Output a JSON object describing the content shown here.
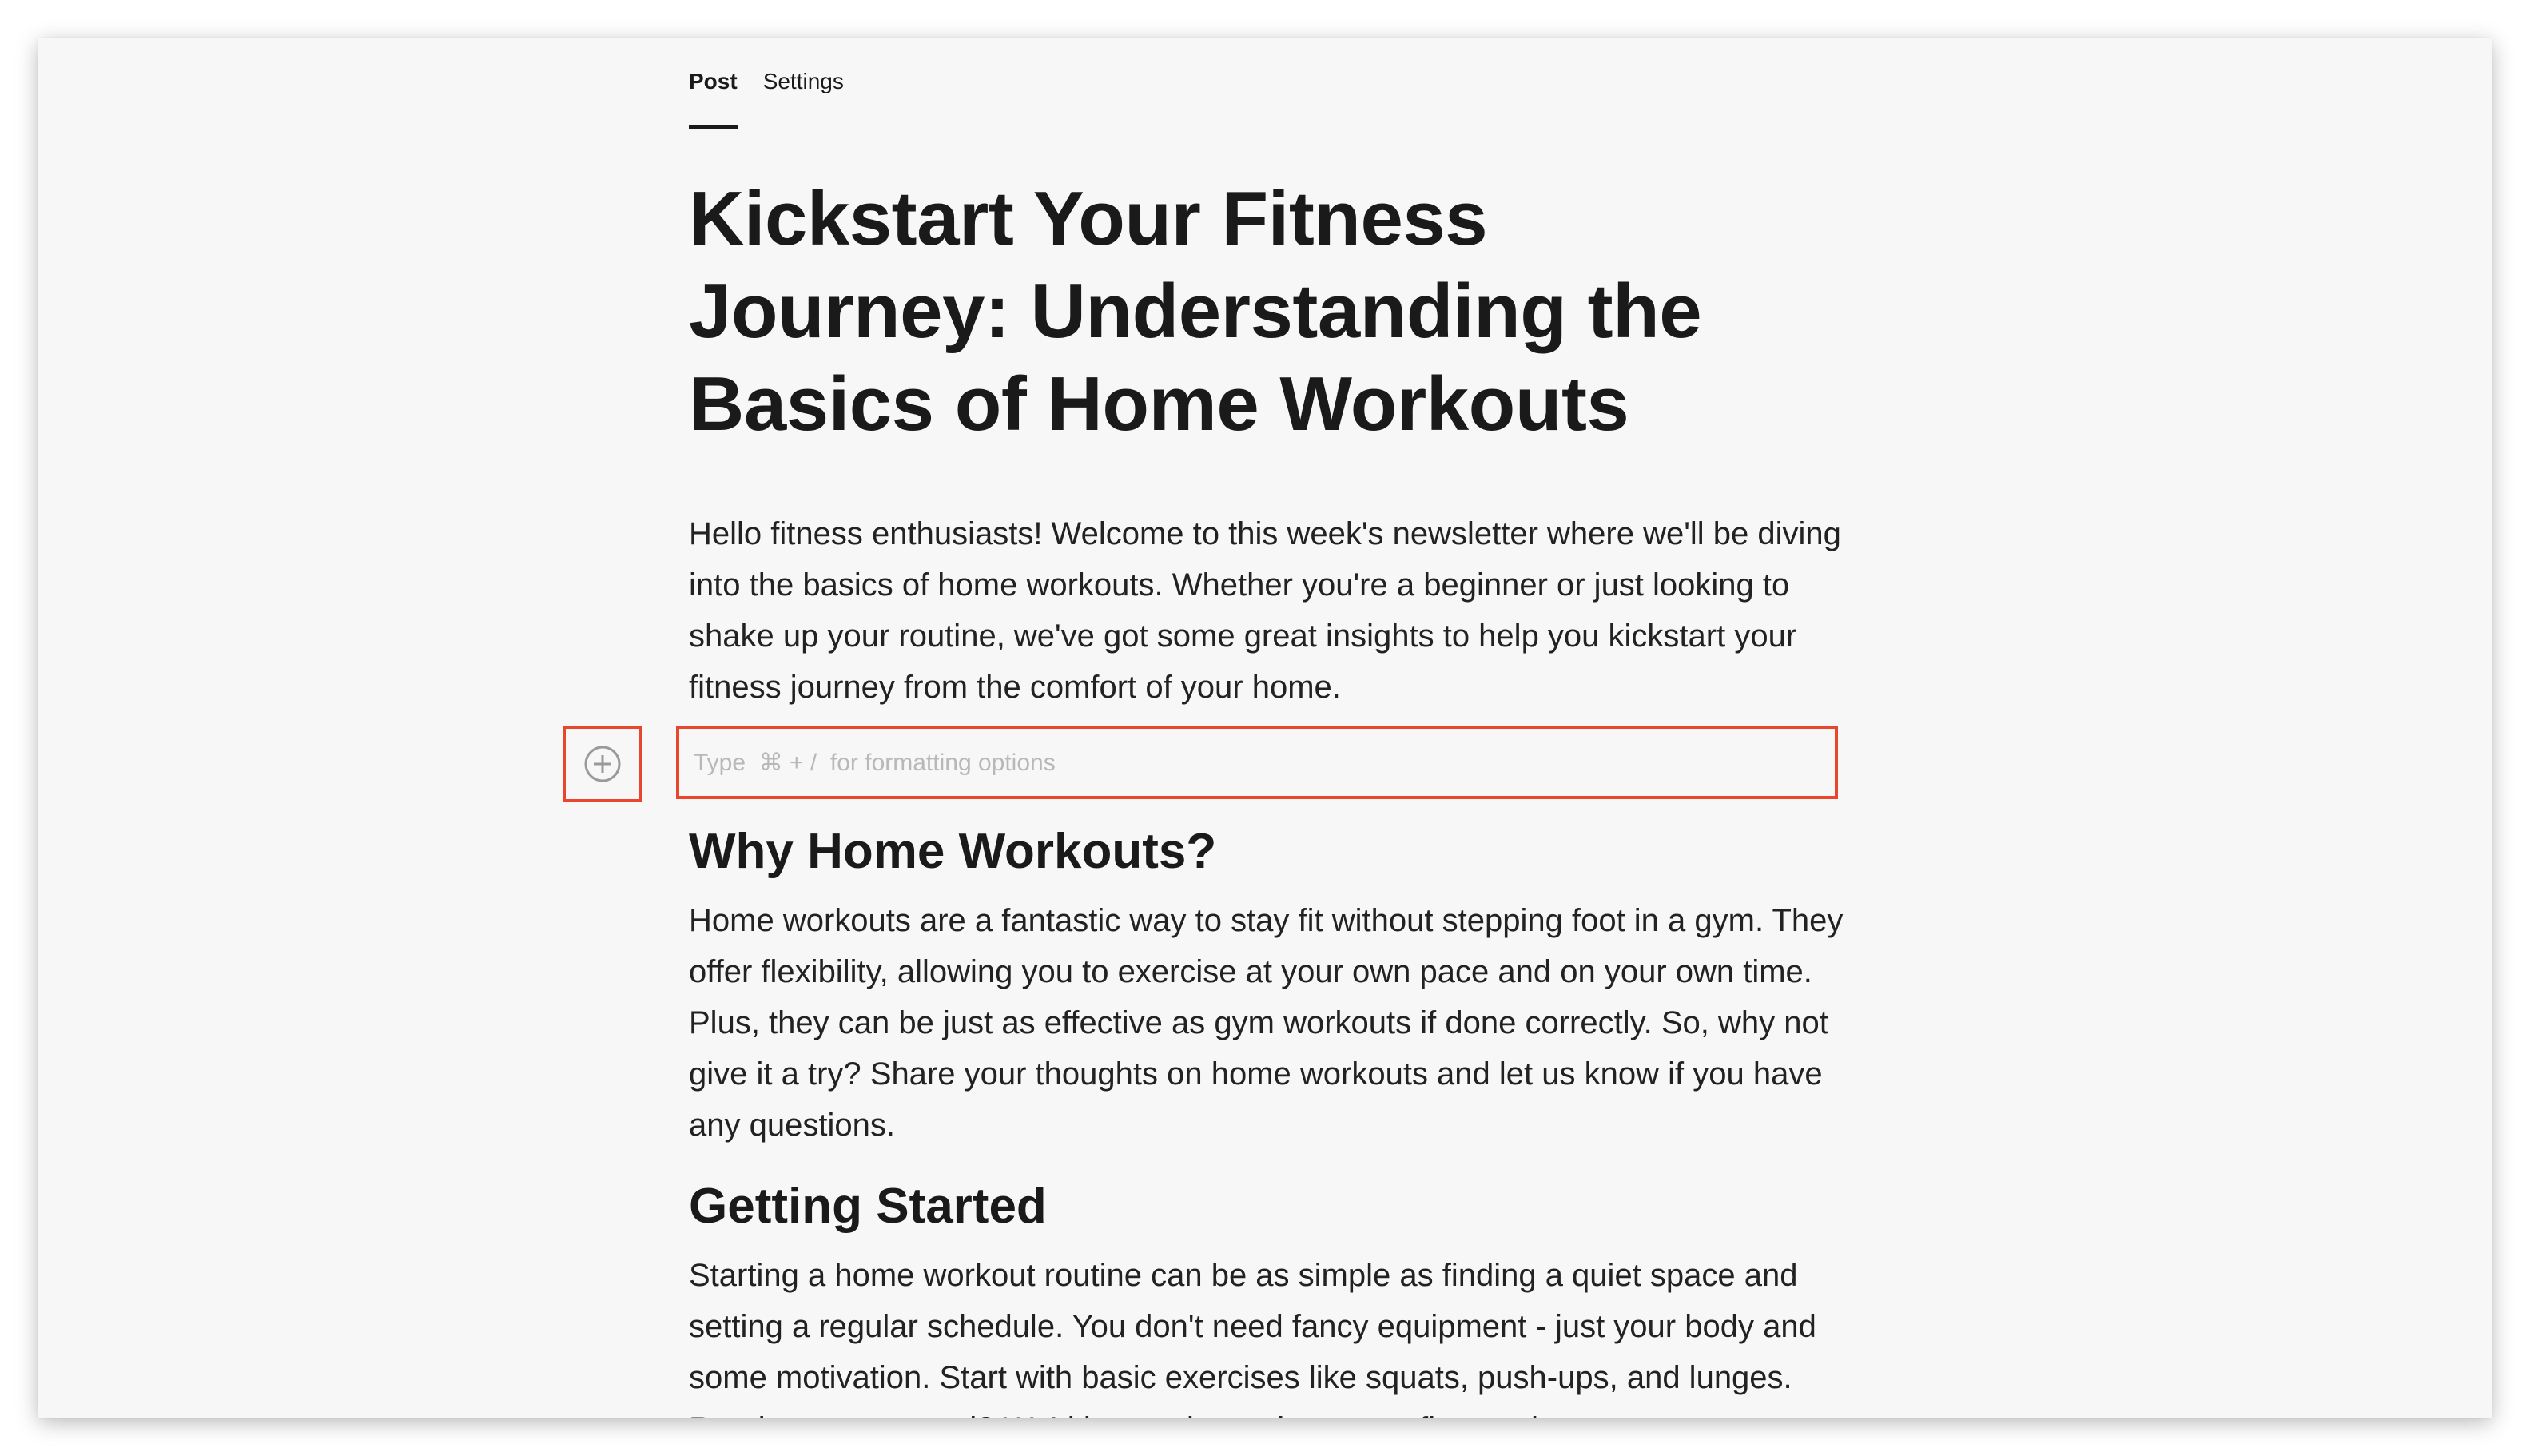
{
  "tabs": [
    {
      "label": "Post",
      "active": true
    },
    {
      "label": "Settings",
      "active": false
    }
  ],
  "post": {
    "title": "Kickstart Your Fitness Journey: Understanding the Basics of Home Workouts",
    "intro": "Hello fitness enthusiasts! Welcome to this week's newsletter where we'll be diving into the basics of home workouts. Whether you're a beginner or just looking to shake up your routine, we've got some great insights to help you kickstart your fitness journey from the comfort of your home.",
    "block_input": {
      "placeholder": "Type  ⌘ + /  for formatting options",
      "value": ""
    },
    "sections": [
      {
        "heading": "Why Home Workouts?",
        "body": "Home workouts are a fantastic way to stay fit without stepping foot in a gym. They offer flexibility, allowing you to exercise at your own pace and on your own time. Plus, they can be just as effective as gym workouts if done correctly. So, why not give it a try? Share your thoughts on home workouts and let us know if you have any questions."
      },
      {
        "heading": "Getting Started",
        "body": "Starting a home workout routine can be as simple as finding a quiet space and setting a regular schedule. You don't need fancy equipment - just your body and some motivation. Start with basic exercises like squats, push-ups, and lunges. Ready to get started? We'd love to hear about your first workout"
      }
    ]
  },
  "icons": {
    "add_block": "plus-circle-icon"
  },
  "colors": {
    "highlight": "#e8472e",
    "text": "#1a1a1a",
    "background": "#f7f7f7",
    "placeholder": "#b8b8b8"
  }
}
